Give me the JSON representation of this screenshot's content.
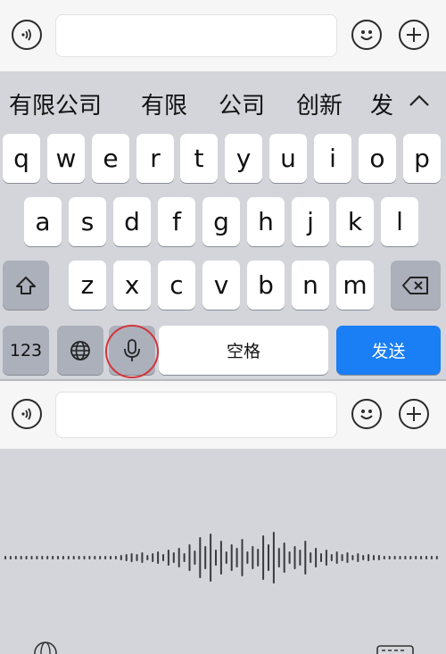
{
  "top_bar": {
    "voice_icon": "voice-wave-icon",
    "input_value": "",
    "emoji_icon": "smiley-icon",
    "add_icon": "plus-icon"
  },
  "candidates": [
    "有限公司",
    "有限",
    "公司",
    "创新",
    "发"
  ],
  "collapse_icon": "chevron-up-icon",
  "keyboard": {
    "row1": [
      "q",
      "w",
      "e",
      "r",
      "t",
      "y",
      "u",
      "i",
      "o",
      "p"
    ],
    "row2": [
      "a",
      "s",
      "d",
      "f",
      "g",
      "h",
      "j",
      "k",
      "l"
    ],
    "row3": [
      "z",
      "x",
      "c",
      "v",
      "b",
      "n",
      "m"
    ],
    "shift_icon": "shift-arrow-icon",
    "delete_icon": "backspace-icon",
    "num_label": "123",
    "globe_icon": "globe-icon",
    "mic_icon": "microphone-icon",
    "space_label": "空格",
    "send_label": "发送"
  },
  "bottom_bar": {
    "voice_icon": "voice-wave-icon",
    "input_value": "",
    "emoji_icon": "smiley-icon",
    "add_icon": "plus-icon"
  },
  "voice_input": {
    "waveform_icon": "audio-waveform-icon",
    "globe_icon": "globe-icon",
    "keyboard_icon": "keyboard-icon"
  },
  "colors": {
    "accent_send": "#1a7ef5",
    "mic_highlight": "#d2363c",
    "keyboard_bg": "#d3d5db"
  }
}
